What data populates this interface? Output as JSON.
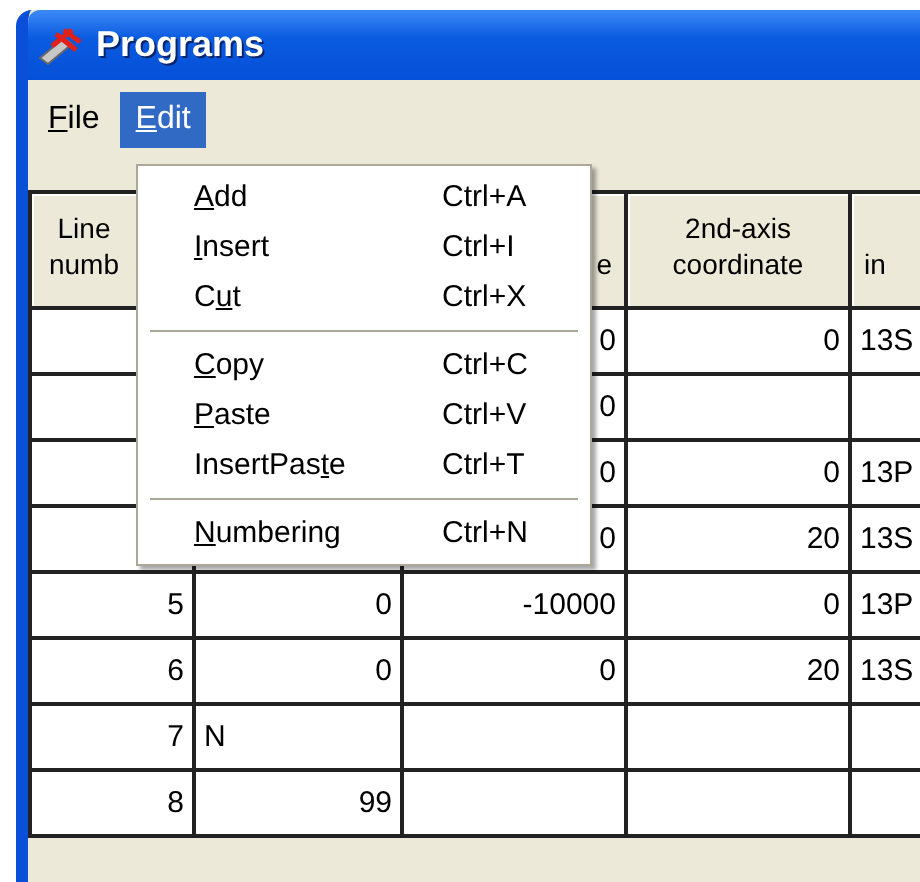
{
  "window": {
    "title": "Programs"
  },
  "menu_bar": [
    {
      "key": "F",
      "after": "ile",
      "selected": false
    },
    {
      "key": "E",
      "after": "dit",
      "selected": true
    }
  ],
  "edit_menu": {
    "groups": [
      [
        {
          "key": "A",
          "after": "dd",
          "shortcut": "Ctrl+A"
        },
        {
          "key": "I",
          "after": "nsert",
          "shortcut": "Ctrl+I"
        },
        {
          "before": "C",
          "key": "u",
          "after": "t",
          "shortcut": "Ctrl+X"
        }
      ],
      [
        {
          "key": "C",
          "after": "opy",
          "shortcut": "Ctrl+C"
        },
        {
          "key": "P",
          "after": "aste",
          "shortcut": "Ctrl+V"
        },
        {
          "before": "InsertPas",
          "key": "t",
          "after": "e",
          "shortcut": "Ctrl+T"
        }
      ],
      [
        {
          "key": "N",
          "after": "umbering",
          "shortcut": "Ctrl+N"
        }
      ]
    ]
  },
  "table": {
    "columns": [
      {
        "label": "Line numb"
      },
      {},
      {
        "label": "e"
      },
      {
        "label": "2nd-axis coordinate"
      },
      {
        "label": "in"
      }
    ],
    "rows": [
      {
        "cells": [
          null,
          null,
          "0",
          "0",
          "13S"
        ]
      },
      {
        "cells": [
          null,
          null,
          "0",
          null,
          null
        ]
      },
      {
        "cells": [
          null,
          null,
          "0",
          "0",
          "13P"
        ]
      },
      {
        "cells": [
          null,
          null,
          "0",
          "20",
          "13S"
        ]
      },
      {
        "cells": [
          "5",
          "0",
          "-10000",
          "0",
          "13P"
        ]
      },
      {
        "cells": [
          "6",
          "0",
          "0",
          "20",
          "13S"
        ]
      },
      {
        "cells": [
          "7",
          "N",
          null,
          null,
          null
        ]
      },
      {
        "cells": [
          "8",
          "99",
          null,
          null,
          null
        ]
      }
    ]
  }
}
